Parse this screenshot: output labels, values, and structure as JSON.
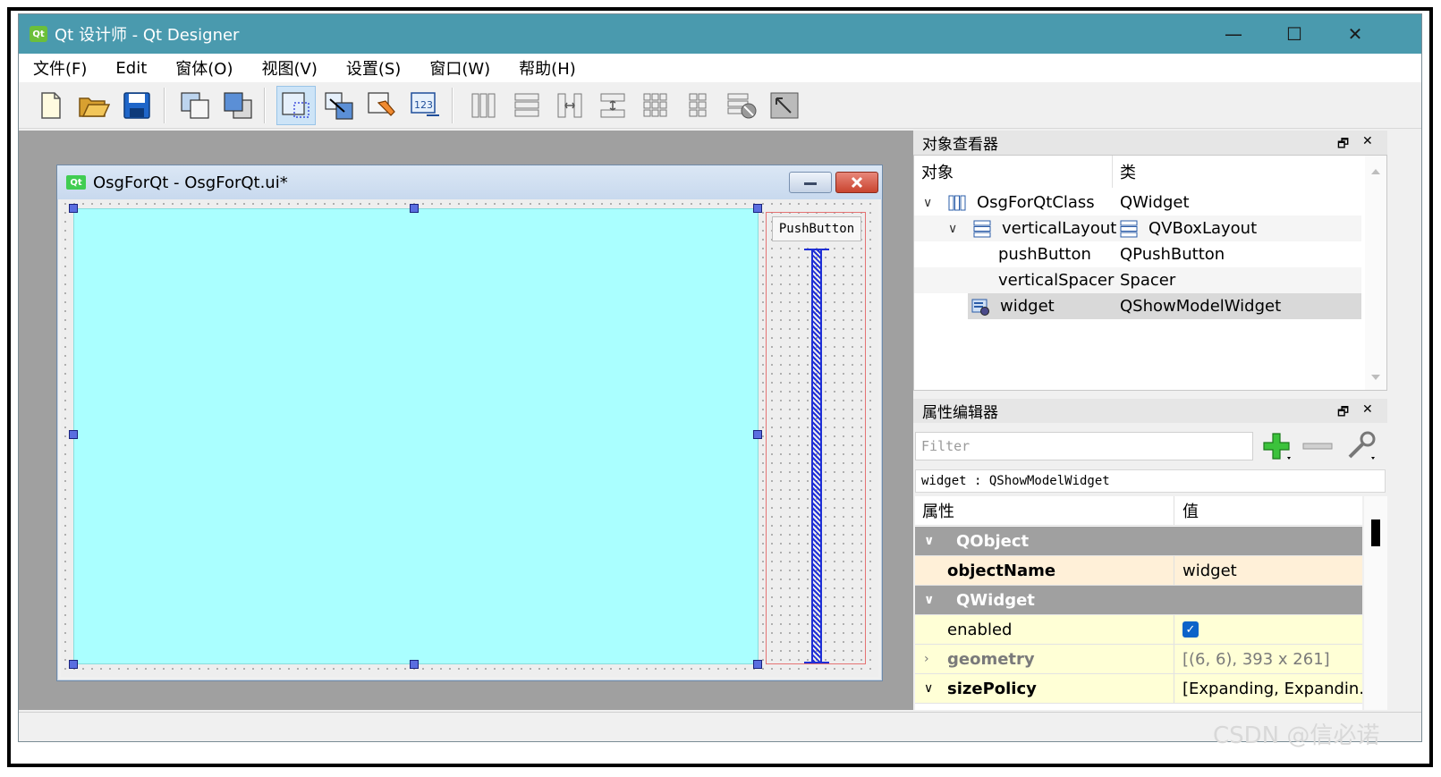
{
  "window": {
    "title": "Qt 设计师 - Qt Designer",
    "minimize": "—",
    "maximize": "☐",
    "close": "✕"
  },
  "menu": [
    "文件(F)",
    "Edit",
    "窗体(O)",
    "视图(V)",
    "设置(S)",
    "窗口(W)",
    "帮助(H)"
  ],
  "form": {
    "icon_text": "Qt",
    "title": "OsgForQt - OsgForQt.ui*",
    "push_button_label": "PushButton"
  },
  "object_inspector": {
    "title": "对象查看器",
    "col_object": "对象",
    "col_class": "类",
    "rows": [
      {
        "object": "OsgForQtClass",
        "class": "QWidget"
      },
      {
        "object": "verticalLayout",
        "class": "QVBoxLayout"
      },
      {
        "object": "pushButton",
        "class": "QPushButton"
      },
      {
        "object": "verticalSpacer",
        "class": "Spacer"
      },
      {
        "object": "widget",
        "class": "QShowModelWidget"
      }
    ]
  },
  "property_editor": {
    "title": "属性编辑器",
    "filter_placeholder": "Filter",
    "class_label": "widget : QShowModelWidget",
    "col_property": "属性",
    "col_value": "值",
    "rows": [
      {
        "name": "QObject",
        "value": ""
      },
      {
        "name": "objectName",
        "value": "widget"
      },
      {
        "name": "QWidget",
        "value": ""
      },
      {
        "name": "enabled",
        "value": "✓"
      },
      {
        "name": "geometry",
        "value": "[(6, 6), 393 x 261]"
      },
      {
        "name": "sizePolicy",
        "value": "[Expanding, Expandin..."
      }
    ]
  },
  "watermark": "CSDN @信必诺",
  "colors": {
    "titlebar": "#4a9aae",
    "canvas_widget": "#aaffff",
    "group_row": "#a0a0a0",
    "selected_row": "#d9d9d9",
    "accent_check": "#0b63c9"
  }
}
